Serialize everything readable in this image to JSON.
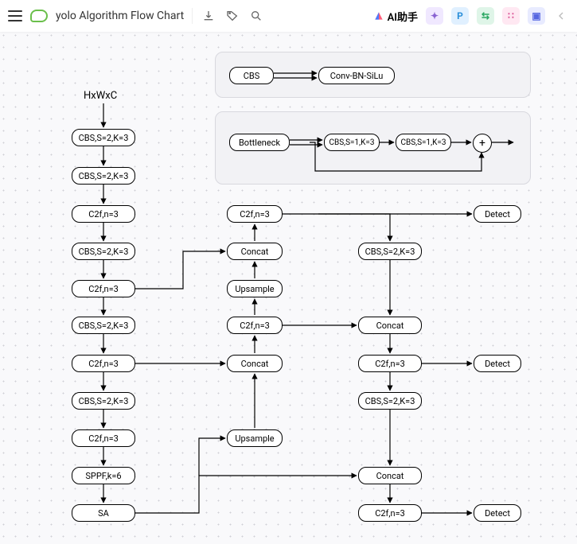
{
  "header": {
    "title": "yolo Algorithm Flow Chart",
    "ai_label": "AI助手"
  },
  "input_label": "HxWxC",
  "legend": {
    "cbs": "CBS",
    "cbs_expand": "Conv-BN-SiLu",
    "bottleneck": "Bottleneck",
    "b1": "CBS,S=1,K=3",
    "b2": "CBS,S=1,K=3",
    "plus": "+"
  },
  "col1": {
    "n1": "CBS,S=2,K=3",
    "n2": "CBS,S=2,K=3",
    "n3": "C2f,n=3",
    "n4": "CBS,S=2,K=3",
    "n5": "C2f,n=3",
    "n6": "CBS,S=2,K=3",
    "n7": "C2f,n=3",
    "n8": "CBS,S=2,K=3",
    "n9": "C2f,n=3",
    "n10": "SPPF,k=6",
    "n11": "SA"
  },
  "col2": {
    "m1": "C2f,n=3",
    "m2": "Concat",
    "m3": "Upsample",
    "m4": "C2f,n=3",
    "m5": "Concat",
    "m6": "Upsample"
  },
  "col3": {
    "r1": "CBS,S=2,K=3",
    "r2": "Concat",
    "r3": "C2f,n=3",
    "r4": "CBS,S=2,K=3",
    "r5": "Concat",
    "r6": "C2f,n=3"
  },
  "detect": {
    "d1": "Detect",
    "d2": "Detect",
    "d3": "Detect"
  }
}
